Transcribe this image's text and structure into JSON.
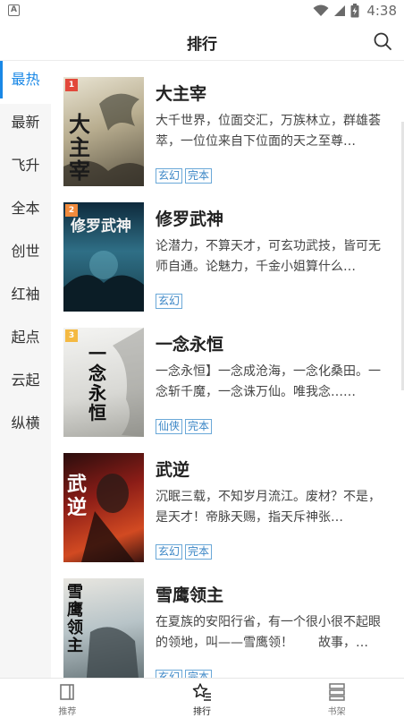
{
  "status_bar": {
    "app_icon_letter": "A",
    "time": "4:38",
    "icons": [
      "wifi-icon",
      "cell-signal-icon",
      "battery-icon"
    ]
  },
  "header": {
    "title": "排行",
    "search_icon": "search-icon"
  },
  "sidebar": {
    "items": [
      {
        "label": "最热",
        "active": true
      },
      {
        "label": "最新"
      },
      {
        "label": "飞升"
      },
      {
        "label": "全本"
      },
      {
        "label": "创世"
      },
      {
        "label": "红袖"
      },
      {
        "label": "起点"
      },
      {
        "label": "云起"
      },
      {
        "label": "纵横"
      }
    ]
  },
  "books": [
    {
      "rank": "1",
      "title": "大主宰",
      "cover_text": "大主宰",
      "description": "大千世界，位面交汇，万族林立，群雄荟萃，一位位来自下位面的天之至尊…",
      "tags": [
        "玄幻",
        "完本"
      ]
    },
    {
      "rank": "2",
      "title": "修罗武神",
      "cover_text": "修罗武神",
      "description": "论潜力，不算天才，可玄功武技，皆可无师自通。论魅力，千金小姐算什么…",
      "tags": [
        "玄幻"
      ]
    },
    {
      "rank": "3",
      "title": "一念永恒",
      "cover_text": "一念永恒",
      "description": "一念永恒】一念成沧海，一念化桑田。一念斩千魔，一念诛万仙。唯我念……",
      "tags": [
        "仙侠",
        "完本"
      ]
    },
    {
      "rank": "",
      "title": "武逆",
      "cover_text": "武逆",
      "description": "沉眠三载，不知岁月流江。废材？不是，是天才！帝脉天赐，指天斥神张…",
      "tags": [
        "玄幻",
        "完本"
      ]
    },
    {
      "rank": "",
      "title": "雪鹰领主",
      "cover_text": "雪鹰领主",
      "description": "在夏族的安阳行省，有一个很小很不起眼的领地，叫——雪鹰领！　　故事，…",
      "tags": [
        "玄幻",
        "完本"
      ]
    }
  ],
  "tabbar": {
    "tabs": [
      {
        "label": "推荐",
        "icon": "book-icon"
      },
      {
        "label": "排行",
        "icon": "ranking-star-icon",
        "active": true
      },
      {
        "label": "书架",
        "icon": "bookshelf-icon"
      }
    ]
  },
  "colors": {
    "accent": "#1a88e6",
    "tag_border": "#6aa8d8",
    "rank_1": "#e2483a",
    "rank_2": "#f08a3c",
    "rank_3": "#f4b942"
  }
}
